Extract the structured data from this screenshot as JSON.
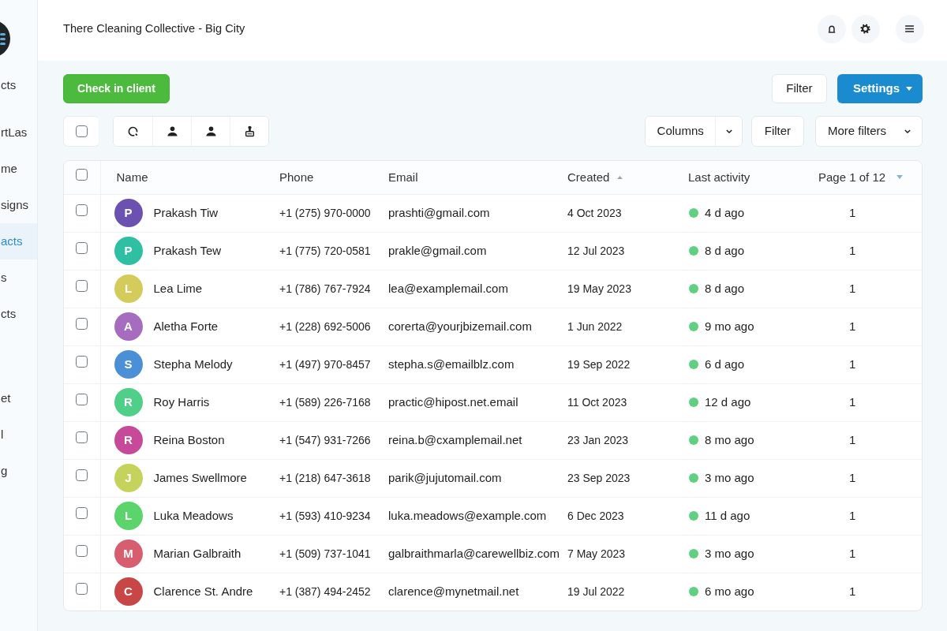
{
  "sidebar": {
    "sections": [
      {
        "items": [
          {
            "label": "cts",
            "selected": false
          }
        ]
      },
      {
        "items": [
          {
            "label": "rtLas",
            "selected": false
          },
          {
            "label": "me",
            "selected": false
          },
          {
            "label": "signs",
            "selected": false
          },
          {
            "label": "acts",
            "selected": true
          },
          {
            "label": "s",
            "selected": false
          },
          {
            "label": "cts",
            "selected": false
          }
        ]
      },
      {
        "items": [
          {
            "label": "et",
            "selected": false
          },
          {
            "label": "l",
            "selected": false
          },
          {
            "label": "g",
            "selected": false
          }
        ]
      }
    ]
  },
  "header": {
    "title": "There Cleaning Collective - Big City"
  },
  "actions": {
    "check_in": "Check in client",
    "filter": "Filter",
    "settings": "Settings"
  },
  "toolbar": {
    "select_all": {
      "checked": false
    },
    "columns": "Columns",
    "filter": "Filter",
    "more_filters": "More filters"
  },
  "table": {
    "select_all": {
      "checked": false
    },
    "columns": [
      {
        "label": "Name",
        "sorted": false,
        "menu": false
      },
      {
        "label": "Phone",
        "sorted": false,
        "menu": false
      },
      {
        "label": "Email",
        "sorted": false,
        "menu": false
      },
      {
        "label": "Created",
        "sorted": true,
        "menu": false
      },
      {
        "label": "Last activity",
        "sorted": false,
        "menu": false
      },
      {
        "label": "Page 1 of 12",
        "sorted": false,
        "menu": true
      }
    ],
    "rows": [
      {
        "checked": false,
        "initial": "P",
        "color": "#6b52b0",
        "name": "Prakash Tiw",
        "phone": "+1 (275) 970-0000",
        "email": "prashti@gmail.com",
        "created": "4 Oct 2023",
        "last_activity": "4 d ago",
        "page": "1"
      },
      {
        "checked": false,
        "initial": "P",
        "color": "#2fbfa3",
        "name": "Prakash Tew",
        "phone": "+1 (775) 720-0581",
        "email": "prakle@gmail.com",
        "created": "12 Jul 2023",
        "last_activity": "8 d ago",
        "page": "1"
      },
      {
        "checked": false,
        "initial": "L",
        "color": "#d3cc5a",
        "name": "Lea Lime",
        "phone": "+1 (786) 767-7924",
        "email": "lea@examplemail.com",
        "created": "19 May 2023",
        "last_activity": "8 d ago",
        "page": "1"
      },
      {
        "checked": false,
        "initial": "A",
        "color": "#a56cbf",
        "name": "Aletha Forte",
        "phone": "+1 (228) 692-5006",
        "email": "corerta@yourjbizemail.com",
        "created": "1 Jun 2022",
        "last_activity": "9 mo ago",
        "page": "1"
      },
      {
        "checked": false,
        "initial": "S",
        "color": "#4b8fd6",
        "name": "Stepha Melody",
        "phone": "+1 (497) 970-8457",
        "email": "stepha.s@emailblz.com",
        "created": "19 Sep 2022",
        "last_activity": "6 d ago",
        "page": "1"
      },
      {
        "checked": false,
        "initial": "R",
        "color": "#4fcf88",
        "name": "Roy Harris",
        "phone": "+1 (589) 226-7168",
        "email": "practic@hipost.net.email",
        "created": "11 Oct 2023",
        "last_activity": "12 d ago",
        "page": "1"
      },
      {
        "checked": false,
        "initial": "R",
        "color": "#c64a99",
        "name": "Reina Boston",
        "phone": "+1 (547) 931-7266",
        "email": "reina.b@cxamplemail.net",
        "created": "23 Jan 2023",
        "last_activity": "8 mo ago",
        "page": "1"
      },
      {
        "checked": false,
        "initial": "J",
        "color": "#c5d35c",
        "name": "James Swellmore",
        "phone": "+1 (218) 647-3618",
        "email": "parik@jujutomail.com",
        "created": "23 Sep 2023",
        "last_activity": "3 mo ago",
        "page": "1"
      },
      {
        "checked": false,
        "initial": "L",
        "color": "#5cd46c",
        "name": "Luka Meadows",
        "phone": "+1 (593) 410-9234",
        "email": "luka.meadows@example.com",
        "created": "6 Dec 2023",
        "last_activity": "11 d ago",
        "page": "1"
      },
      {
        "checked": false,
        "initial": "M",
        "color": "#d75e6f",
        "name": "Marian Galbraith",
        "phone": "+1 (509) 737-1041",
        "email": "galbraithmarla@carewellbiz.com",
        "created": "7 May 2023",
        "last_activity": "3 mo ago",
        "page": "1"
      },
      {
        "checked": false,
        "initial": "C",
        "color": "#c84646",
        "name": "Clarence St. Andre",
        "phone": "+1 (387) 494-2452",
        "email": "clarence@mynetmail.net",
        "created": "19 Jul 2022",
        "last_activity": "6 mo ago",
        "page": "1"
      }
    ]
  }
}
